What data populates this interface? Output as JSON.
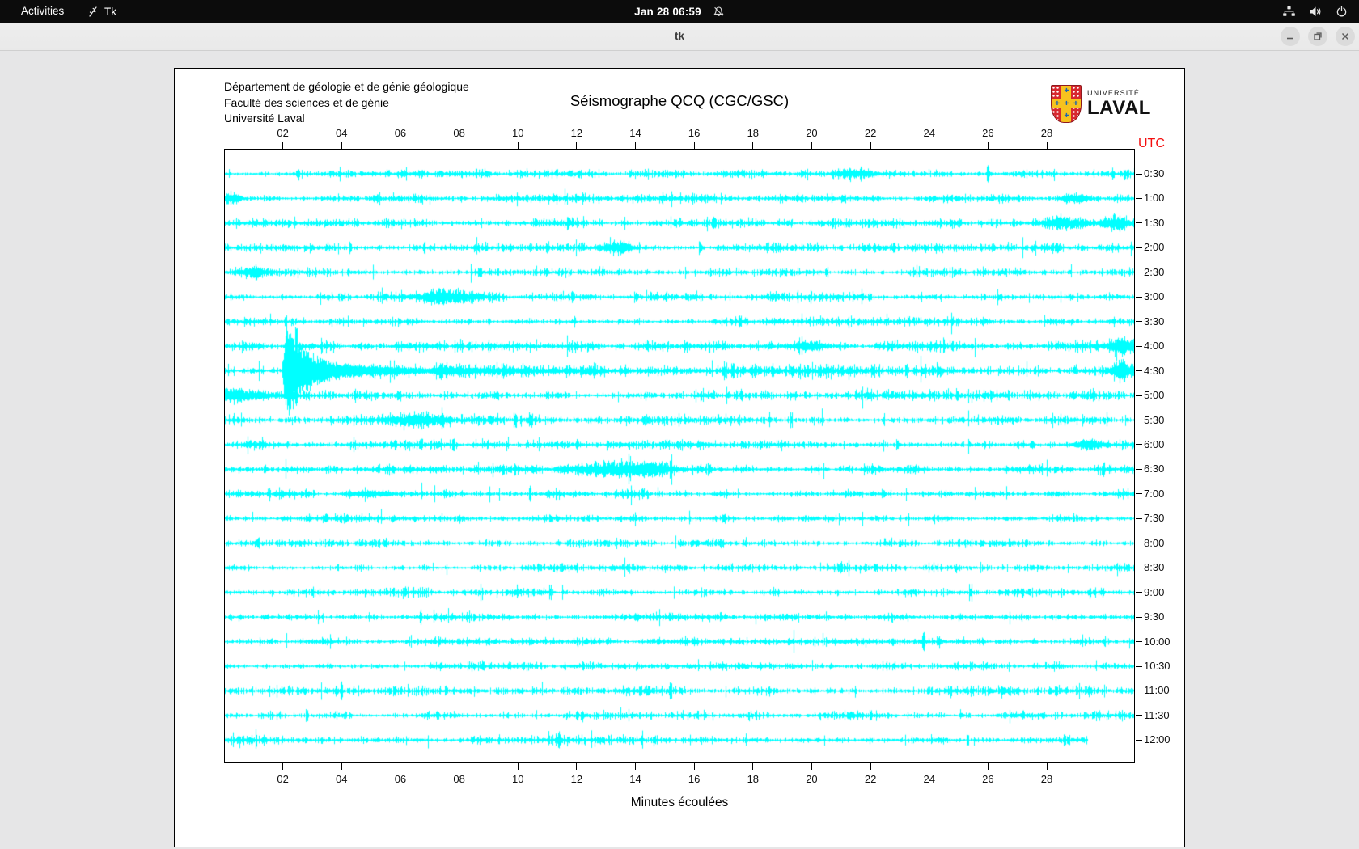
{
  "topbar": {
    "activities": "Activities",
    "app": "Tk",
    "clock": "Jan 28 06:59"
  },
  "titlebar": {
    "title": "tk"
  },
  "header": {
    "line1": "Département de géologie et de génie géologique",
    "line2": "Faculté des sciences et de génie",
    "line3": "Université Laval"
  },
  "logo": {
    "small": "UNIVERSITÉ",
    "large": "LAVAL"
  },
  "chart_data": {
    "type": "line",
    "title": "Séismographe QCQ (CGC/GSC)",
    "xlabel": "Minutes écoulées",
    "right_axis_label": "UTC",
    "right_axis_color": "#f40e0e",
    "trace_color": "#00ffff",
    "x_tick_labels": [
      "02",
      "04",
      "06",
      "08",
      "10",
      "12",
      "14",
      "16",
      "18",
      "20",
      "22",
      "24",
      "26",
      "28"
    ],
    "x_tick_minutes": [
      2,
      4,
      6,
      8,
      10,
      12,
      14,
      16,
      18,
      20,
      22,
      24,
      26,
      28
    ],
    "x_range_minutes": [
      0,
      31
    ],
    "grid": false,
    "legend": "none",
    "rows": [
      {
        "utc": "0:30",
        "base": 2.0,
        "events": [
          {
            "k": "spike",
            "m": 2.5,
            "a": 5
          },
          {
            "k": "spike",
            "m": 3.9,
            "a": 5
          },
          {
            "k": "burst",
            "m": 21.5,
            "a": 3,
            "w": 0.4
          },
          {
            "k": "spike",
            "m": 26.0,
            "a": 6
          }
        ]
      },
      {
        "utc": "1:00",
        "base": 2.0,
        "events": [
          {
            "k": "burst",
            "m": 0.3,
            "a": 5,
            "w": 0.2
          },
          {
            "k": "spike",
            "m": 5.2,
            "a": 4
          },
          {
            "k": "spike",
            "m": 18.2,
            "a": 5
          },
          {
            "k": "burst",
            "m": 28.9,
            "a": 4,
            "w": 0.3
          }
        ]
      },
      {
        "utc": "1:30",
        "base": 2.2,
        "events": [
          {
            "k": "spike",
            "m": 11.7,
            "a": 5
          },
          {
            "k": "spike",
            "m": 16.7,
            "a": 6
          },
          {
            "k": "spike",
            "m": 20.7,
            "a": 5
          },
          {
            "k": "burst",
            "m": 28.7,
            "a": 6,
            "w": 0.5
          },
          {
            "k": "burst",
            "m": 30.3,
            "a": 7,
            "w": 0.3
          }
        ]
      },
      {
        "utc": "2:00",
        "base": 2.2,
        "events": [
          {
            "k": "spike",
            "m": 4.3,
            "a": 7
          },
          {
            "k": "spike",
            "m": 6.8,
            "a": 5
          },
          {
            "k": "burst",
            "m": 13.4,
            "a": 5,
            "w": 0.3
          },
          {
            "k": "spike",
            "m": 16.2,
            "a": 5
          },
          {
            "k": "spike",
            "m": 22.8,
            "a": 5
          }
        ]
      },
      {
        "utc": "2:30",
        "base": 2.0,
        "events": [
          {
            "k": "burst",
            "m": 1.0,
            "a": 5,
            "w": 0.25
          },
          {
            "k": "spike",
            "m": 9.3,
            "a": 4
          },
          {
            "k": "spike",
            "m": 20.5,
            "a": 5
          }
        ]
      },
      {
        "utc": "3:00",
        "base": 2.2,
        "events": [
          {
            "k": "burst",
            "m": 7.5,
            "a": 6,
            "w": 0.7
          },
          {
            "k": "spike",
            "m": 14.0,
            "a": 4
          },
          {
            "k": "spike",
            "m": 22.0,
            "a": 5
          }
        ]
      },
      {
        "utc": "3:30",
        "base": 2.0,
        "events": [
          {
            "k": "spike",
            "m": 2.1,
            "a": 5
          },
          {
            "k": "spike",
            "m": 9.0,
            "a": 3.5
          }
        ]
      },
      {
        "utc": "4:00",
        "base": 2.5,
        "events": [
          {
            "k": "spike",
            "m": 2.45,
            "a": 26,
            "bias": "up"
          },
          {
            "k": "burst",
            "m": 19.9,
            "a": 4,
            "w": 0.4
          },
          {
            "k": "spike",
            "m": 24.5,
            "a": 5
          },
          {
            "k": "burst",
            "m": 30.5,
            "a": 8,
            "w": 0.25
          }
        ]
      },
      {
        "utc": "4:30",
        "base": 3.0,
        "events": [
          {
            "k": "quake",
            "m": 1.95,
            "a": 44
          },
          {
            "k": "spike",
            "m": 17.3,
            "a": 7
          },
          {
            "k": "spike",
            "m": 23.2,
            "a": 8
          },
          {
            "k": "burst",
            "m": 30.5,
            "a": 11,
            "w": 0.2
          }
        ]
      },
      {
        "utc": "5:00",
        "base": 2.6,
        "events": [
          {
            "k": "burst",
            "m": 0.0,
            "a": 6,
            "w": 1.2
          },
          {
            "k": "spike",
            "m": 2.45,
            "a": 13,
            "bias": "down"
          },
          {
            "k": "spike",
            "m": 9.6,
            "a": 5
          },
          {
            "k": "spike",
            "m": 11.0,
            "a": 4
          }
        ]
      },
      {
        "utc": "5:30",
        "base": 2.4,
        "events": [
          {
            "k": "burst",
            "m": 6.5,
            "a": 5,
            "w": 0.6
          },
          {
            "k": "spike",
            "m": 7.4,
            "a": 5
          },
          {
            "k": "spike",
            "m": 9.9,
            "a": 7
          },
          {
            "k": "spike",
            "m": 10.4,
            "a": 6
          },
          {
            "k": "spike",
            "m": 19.3,
            "a": 9
          }
        ]
      },
      {
        "utc": "6:00",
        "base": 2.2,
        "events": [
          {
            "k": "spike",
            "m": 7.8,
            "a": 6
          },
          {
            "k": "spike",
            "m": 22.9,
            "a": 8
          },
          {
            "k": "spike",
            "m": 27.5,
            "a": 4
          },
          {
            "k": "burst",
            "m": 29.4,
            "a": 5,
            "w": 0.3
          }
        ]
      },
      {
        "utc": "6:30",
        "base": 2.4,
        "events": [
          {
            "k": "burst",
            "m": 13.0,
            "a": 6,
            "w": 0.8
          },
          {
            "k": "spike",
            "m": 13.8,
            "a": 11
          },
          {
            "k": "burst",
            "m": 14.5,
            "a": 6,
            "w": 0.5
          },
          {
            "k": "spike",
            "m": 15.2,
            "a": 12
          },
          {
            "k": "spike",
            "m": 16.5,
            "a": 6
          }
        ]
      },
      {
        "utc": "7:00",
        "base": 2.2,
        "events": [
          {
            "k": "spike",
            "m": 1.9,
            "a": 4
          },
          {
            "k": "burst",
            "m": 5.0,
            "a": 3,
            "w": 0.5
          },
          {
            "k": "spike",
            "m": 10.4,
            "a": 5
          }
        ]
      },
      {
        "utc": "7:30",
        "base": 2.0,
        "events": [
          {
            "k": "spike",
            "m": 8.0,
            "a": 3
          },
          {
            "k": "spike",
            "m": 17.0,
            "a": 4
          }
        ]
      },
      {
        "utc": "8:00",
        "base": 2.0,
        "events": [
          {
            "k": "spike",
            "m": 5.5,
            "a": 4
          },
          {
            "k": "spike",
            "m": 25.0,
            "a": 5
          }
        ]
      },
      {
        "utc": "8:30",
        "base": 2.0,
        "events": [
          {
            "k": "spike",
            "m": 12.0,
            "a": 4
          },
          {
            "k": "spike",
            "m": 21.0,
            "a": 4
          }
        ]
      },
      {
        "utc": "9:00",
        "base": 2.2,
        "events": [
          {
            "k": "spike",
            "m": 3.0,
            "a": 4
          },
          {
            "k": "spike",
            "m": 11.1,
            "a": 8
          },
          {
            "k": "spike",
            "m": 25.4,
            "a": 9
          }
        ]
      },
      {
        "utc": "9:30",
        "base": 2.0,
        "events": [
          {
            "k": "spike",
            "m": 6.7,
            "a": 8
          },
          {
            "k": "spike",
            "m": 14.0,
            "a": 4
          }
        ]
      },
      {
        "utc": "10:00",
        "base": 2.0,
        "events": [
          {
            "k": "spike",
            "m": 9.0,
            "a": 4
          },
          {
            "k": "spike",
            "m": 23.8,
            "a": 10
          }
        ]
      },
      {
        "utc": "10:30",
        "base": 2.0,
        "events": [
          {
            "k": "spike",
            "m": 8.8,
            "a": 4
          },
          {
            "k": "spike",
            "m": 17.5,
            "a": 4
          }
        ]
      },
      {
        "utc": "11:00",
        "base": 2.2,
        "events": [
          {
            "k": "spike",
            "m": 4.0,
            "a": 6
          },
          {
            "k": "spike",
            "m": 15.2,
            "a": 10
          },
          {
            "k": "spike",
            "m": 26.5,
            "a": 4
          }
        ]
      },
      {
        "utc": "11:30",
        "base": 2.0,
        "events": [
          {
            "k": "spike",
            "m": 2.8,
            "a": 6
          },
          {
            "k": "spike",
            "m": 12.2,
            "a": 4
          },
          {
            "k": "spike",
            "m": 22.0,
            "a": 4
          }
        ]
      },
      {
        "utc": "12:00",
        "base": 2.2,
        "end_minute": 29.4,
        "events": [
          {
            "k": "spike",
            "m": 11.4,
            "a": 7
          },
          {
            "k": "spike",
            "m": 14.2,
            "a": 5
          },
          {
            "k": "spike",
            "m": 25.3,
            "a": 6
          },
          {
            "k": "spike",
            "m": 28.6,
            "a": 5
          }
        ]
      }
    ]
  }
}
